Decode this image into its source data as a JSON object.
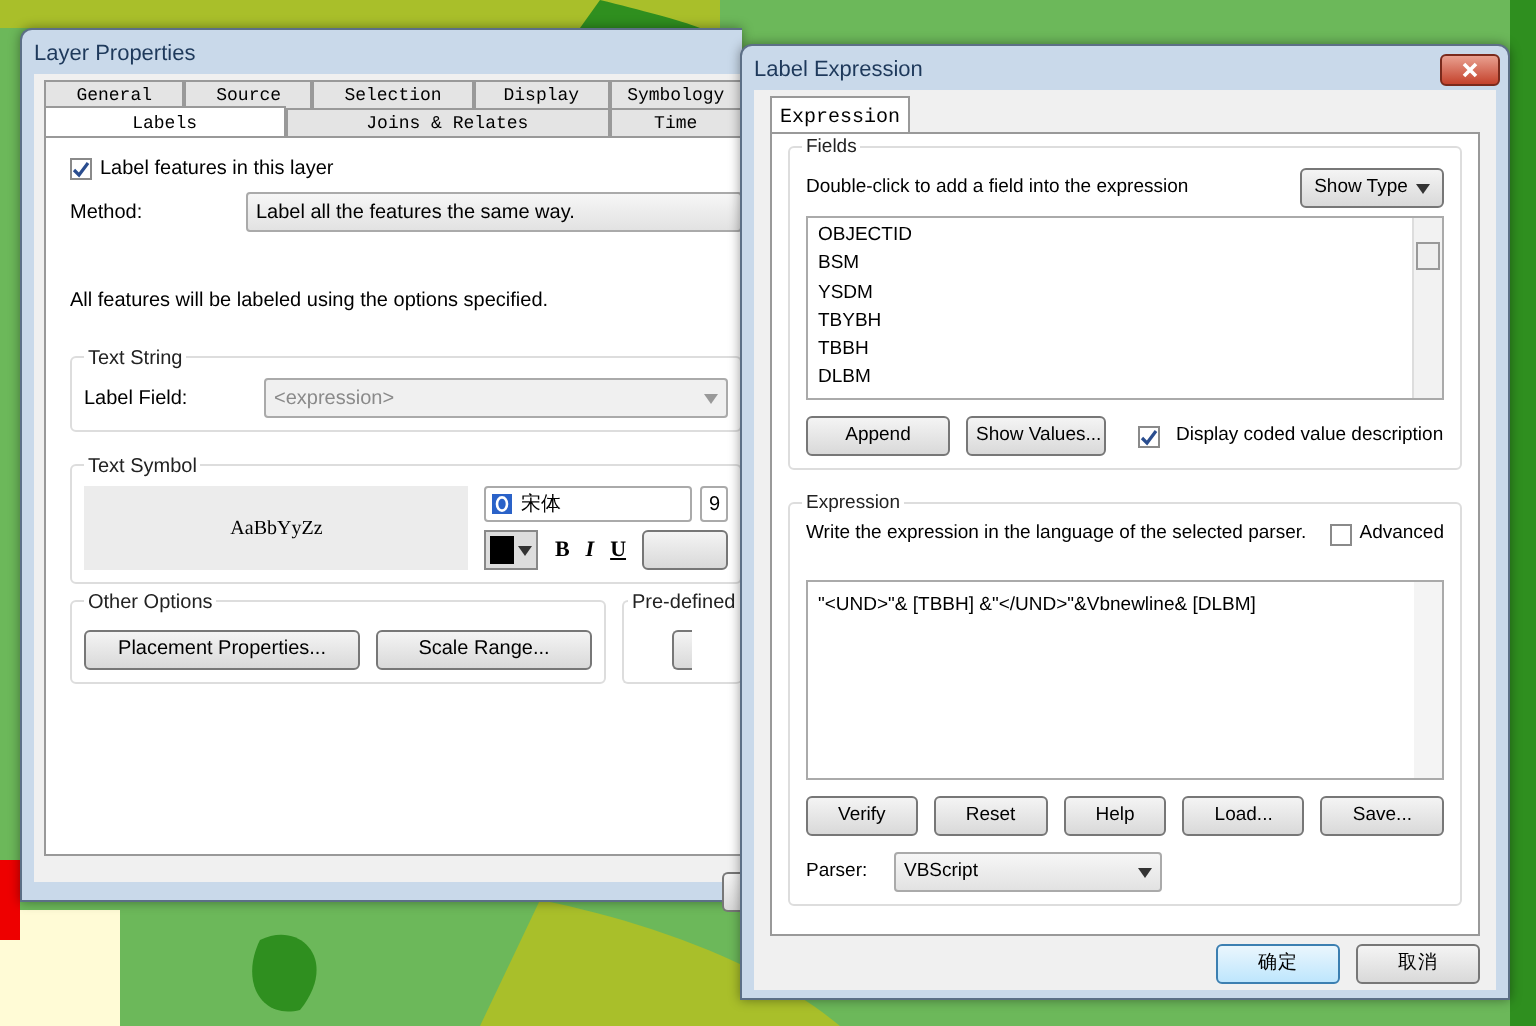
{
  "layer_properties": {
    "title": "Layer Properties",
    "tabs_row_1": [
      {
        "label": "General",
        "selected": false
      },
      {
        "label": "Source",
        "selected": false
      },
      {
        "label": "Selection",
        "selected": false
      },
      {
        "label": "Display",
        "selected": false
      },
      {
        "label": "Symbology",
        "selected": false
      }
    ],
    "tabs_row_2": [
      {
        "label": "Labels",
        "selected": true
      },
      {
        "label": "Joins & Relates",
        "selected": false
      },
      {
        "label": "Time",
        "selected": false
      }
    ],
    "label_features": {
      "label": "Label features in this layer",
      "checked": true
    },
    "method": {
      "label": "Method:",
      "value": "Label all the features the same way."
    },
    "info": "All features will be labeled using the options specified.",
    "text_string": {
      "title": "Text String",
      "label": "Label Field:",
      "value": "<expression>",
      "disabled": true
    },
    "text_symbol": {
      "title": "Text Symbol",
      "preview": "AaBbYyZz",
      "font": "宋体",
      "size": "9",
      "bold": "B",
      "italic": "I",
      "underline": "U"
    },
    "other_options": {
      "title": "Other Options",
      "buttons": [
        "Placement Properties...",
        "Scale Range..."
      ]
    },
    "predefined": {
      "title": "Pre-defined"
    }
  },
  "label_expression": {
    "title": "Label Expression",
    "tab": "Expression",
    "fields": {
      "title": "Fields",
      "hint": "Double-click to add a field into the expression",
      "show_type": "Show Type",
      "items": [
        "OBJECTID",
        "BSM",
        "YSDM",
        "TBYBH",
        "TBBH",
        "DLBM"
      ],
      "buttons": [
        "Append",
        "Show Values..."
      ],
      "coded": {
        "label": "Display coded value description",
        "checked": true
      }
    },
    "expression": {
      "title": "Expression",
      "hint": "Write the expression in the language of the selected parser.",
      "advanced": {
        "label": "Advanced",
        "checked": false
      },
      "value": "\"<UND>\"& [TBBH] &\"</UND>\"&Vbnewline& [DLBM]",
      "buttons": [
        "Verify",
        "Reset",
        "Help",
        "Load...",
        "Save..."
      ],
      "parser_label": "Parser:",
      "parser": "VBScript"
    },
    "ok": "确定",
    "cancel": "取消"
  }
}
